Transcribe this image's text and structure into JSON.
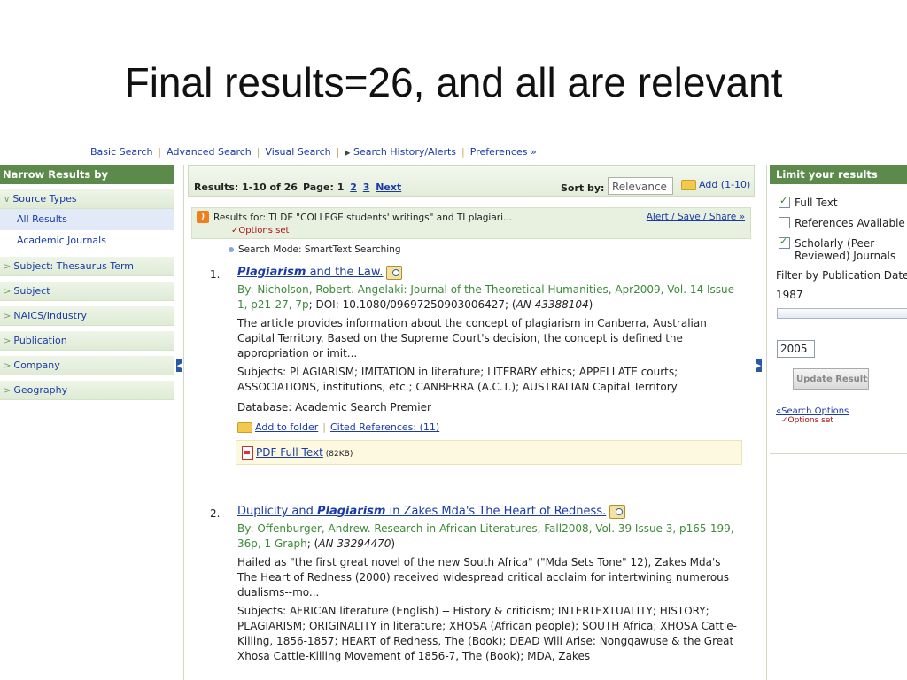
{
  "slide": {
    "title": "Final results=26, and all are relevant"
  },
  "topnav": {
    "basic": "Basic Search",
    "advanced": "Advanced Search",
    "visual": "Visual Search",
    "history": "Search History/Alerts",
    "preferences": "Preferences »"
  },
  "left": {
    "heading": "Narrow Results by",
    "source_types": "Source Types",
    "all_results": "All Results",
    "academic": "Academic Journals",
    "facets": [
      "Subject: Thesaurus Term",
      "Subject",
      "NAICS/Industry",
      "Publication",
      "Company",
      "Geography"
    ]
  },
  "results": {
    "count": "Results: 1-10 of 26",
    "page_label": "Page: 1",
    "page2": "2",
    "page3": "3",
    "next": "Next",
    "sort_label": "Sort by:",
    "sort_value": "Relevance",
    "add": "Add (1-10)",
    "results_for": "Results for:  TI DE \"COLLEGE students' writings\" and TI plagiari...",
    "options_set": "✓Options set",
    "alert_links": "Alert / Save / Share »",
    "search_mode": "Search Mode: SmartText Searching"
  },
  "items": [
    {
      "num": "1.",
      "title_hl": "Plagiarism",
      "title_rest": " and the Law.",
      "byline": "By: Nicholson, Robert. Angelaki: Journal of the Theoretical Humanities, Apr2009, Vol. 14 Issue 1, p21-27, 7p",
      "doi": "; DOI: 10.1080/09697250903006427; (",
      "an": "AN 43388104",
      "abstract": "The article provides information about the concept of plagiarism in Canberra, Australian Capital Territory. Based on the Supreme Court's decision, the concept is defined the appropriation or imit...",
      "subjects": "Subjects: PLAGIARISM; IMITATION in literature; LITERARY ethics; APPELLATE courts; ASSOCIATIONS, institutions, etc.; CANBERRA (A.C.T.); AUSTRALIAN Capital Territory",
      "database": "Database: Academic Search Premier",
      "add_folder": "Add to folder",
      "cited": "Cited References: (11)",
      "pdf": "PDF Full Text",
      "pdf_size": "(82KB)"
    },
    {
      "num": "2.",
      "title_pre": "Duplicity and ",
      "title_hl": "Plagiarism",
      "title_rest": " in Zakes Mda's The Heart of Redness.",
      "byline": "By: Offenburger, Andrew. Research in African Literatures, Fall2008, Vol. 39 Issue 3, p165-199, 36p, 1 Graph",
      "an": "AN 33294470",
      "abstract": "Hailed as \"the first great novel of the new South Africa\" (\"Mda Sets Tone\" 12), Zakes Mda's The Heart of Redness (2000) received widespread critical acclaim for intertwining numerous dualisms--mo...",
      "subjects": "Subjects: AFRICAN literature (English) -- History & criticism; INTERTEXTUALITY; HISTORY; PLAGIARISM; ORIGINALITY in literature; XHOSA (African people); SOUTH Africa; XHOSA Cattle-Killing, 1856-1857; HEART of Redness, The (Book); DEAD Will Arise: Nongqawuse & the Great Xhosa Cattle-Killing Movement of 1856-7, The (Book); MDA, Zakes"
    }
  ],
  "right": {
    "heading": "Limit your results",
    "full_text": "Full Text",
    "references": "References Available",
    "scholarly_1": "Scholarly (Peer",
    "scholarly_2": "Reviewed) Journals",
    "filter_label": "Filter by Publication Date",
    "year_from": "1987",
    "year_to": "2005",
    "update": "Update Results",
    "search_options": "«Search Options",
    "options_set": "✓Options set"
  }
}
